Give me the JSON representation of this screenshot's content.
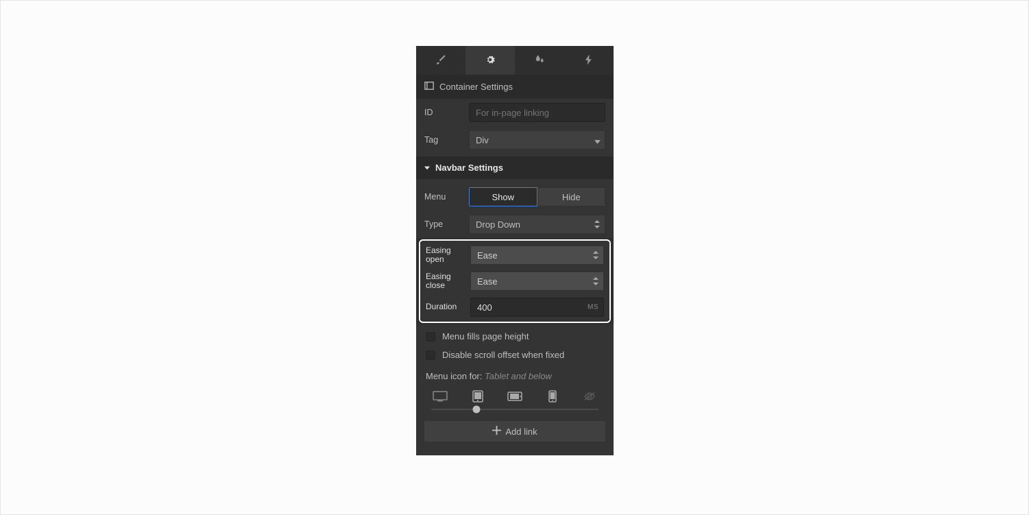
{
  "container": {
    "section_title": "Container Settings",
    "id_label": "ID",
    "id_placeholder": "For in-page linking",
    "tag_label": "Tag",
    "tag_value": "Div"
  },
  "navbar": {
    "section_title": "Navbar Settings",
    "menu_label": "Menu",
    "menu_show": "Show",
    "menu_hide": "Hide",
    "type_label": "Type",
    "type_value": "Drop Down",
    "easing_open_label": "Easing open",
    "easing_open_value": "Ease",
    "easing_close_label": "Easing close",
    "easing_close_value": "Ease",
    "duration_label": "Duration",
    "duration_value": "400",
    "duration_unit": "MS",
    "fills_label": "Menu fills page height",
    "disable_scroll_label": "Disable scroll offset when fixed",
    "menu_icon_label": "Menu icon for: ",
    "menu_icon_value": "Tablet and below",
    "add_link_label": "Add link"
  }
}
